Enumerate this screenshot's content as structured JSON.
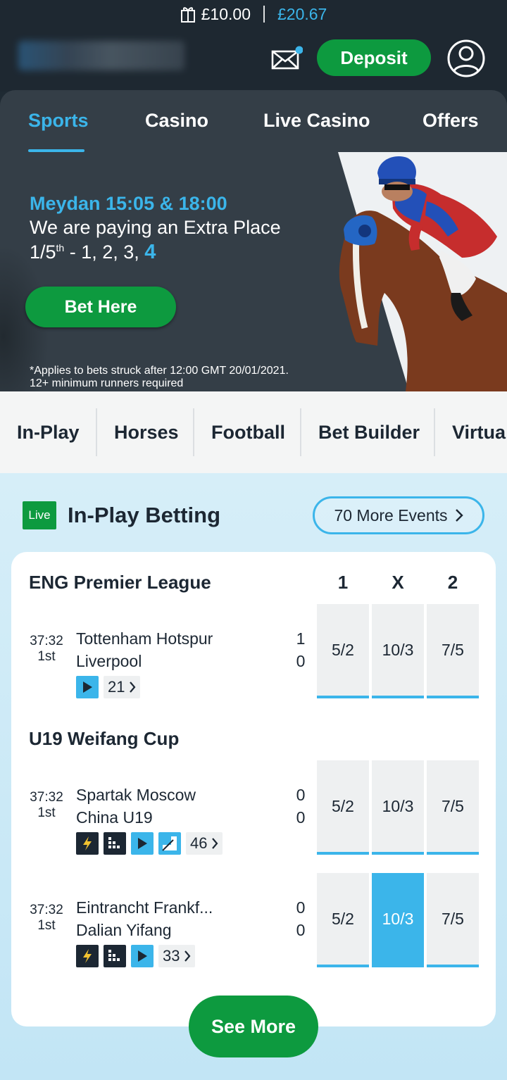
{
  "header": {
    "cash_balance": "£10.00",
    "total_balance": "£20.67",
    "deposit_label": "Deposit"
  },
  "nav": {
    "tabs": [
      {
        "label": "Sports"
      },
      {
        "label": "Casino"
      },
      {
        "label": "Live Casino"
      },
      {
        "label": "Offers"
      }
    ]
  },
  "banner": {
    "title": "Meydan 15:05 & 18:00",
    "line2": "We are paying an Extra Place",
    "line3_prefix": "1/5",
    "line3_sup": "th",
    "line3_rest": " - 1, 2, 3, ",
    "line3_highlight": "4",
    "cta_label": "Bet Here",
    "disclaimer_1": "*Applies to bets struck after 12:00 GMT 20/01/2021.",
    "disclaimer_2": "12+ minimum runners required"
  },
  "sport_tabs": [
    {
      "label": "In-Play"
    },
    {
      "label": "Horses"
    },
    {
      "label": "Football"
    },
    {
      "label": "Bet Builder"
    },
    {
      "label": "Virtua"
    }
  ],
  "inplay": {
    "live_badge": "Live",
    "title": "In-Play Betting",
    "more_events_label": "70 More Events",
    "columns": [
      "1",
      "X",
      "2"
    ],
    "leagues": [
      {
        "name": "ENG Premier League",
        "matches": [
          {
            "time": "37:32",
            "period": "1st",
            "home": "Tottenham Hotspur",
            "away": "Liverpool",
            "home_score": "1",
            "away_score": "0",
            "markets": "21",
            "odds": [
              "5/2",
              "10/3",
              "7/5"
            ]
          }
        ]
      },
      {
        "name": "U19 Weifang Cup",
        "matches": [
          {
            "time": "37:32",
            "period": "1st",
            "home": "Spartak Moscow",
            "away": "China U19",
            "home_score": "0",
            "away_score": "0",
            "markets": "46",
            "odds": [
              "5/2",
              "10/3",
              "7/5"
            ]
          },
          {
            "time": "37:32",
            "period": "1st",
            "home": "Eintrancht Frankf...",
            "away": "Dalian Yifang",
            "home_score": "0",
            "away_score": "0",
            "markets": "33",
            "odds": [
              "5/2",
              "10/3",
              "7/5"
            ],
            "selected_odd": "10/3"
          }
        ]
      }
    ],
    "see_more_label": "See More"
  },
  "colors": {
    "accent_blue": "#3bb5ea",
    "brand_green": "#0d9a3f",
    "header_dark": "#1e2831"
  }
}
